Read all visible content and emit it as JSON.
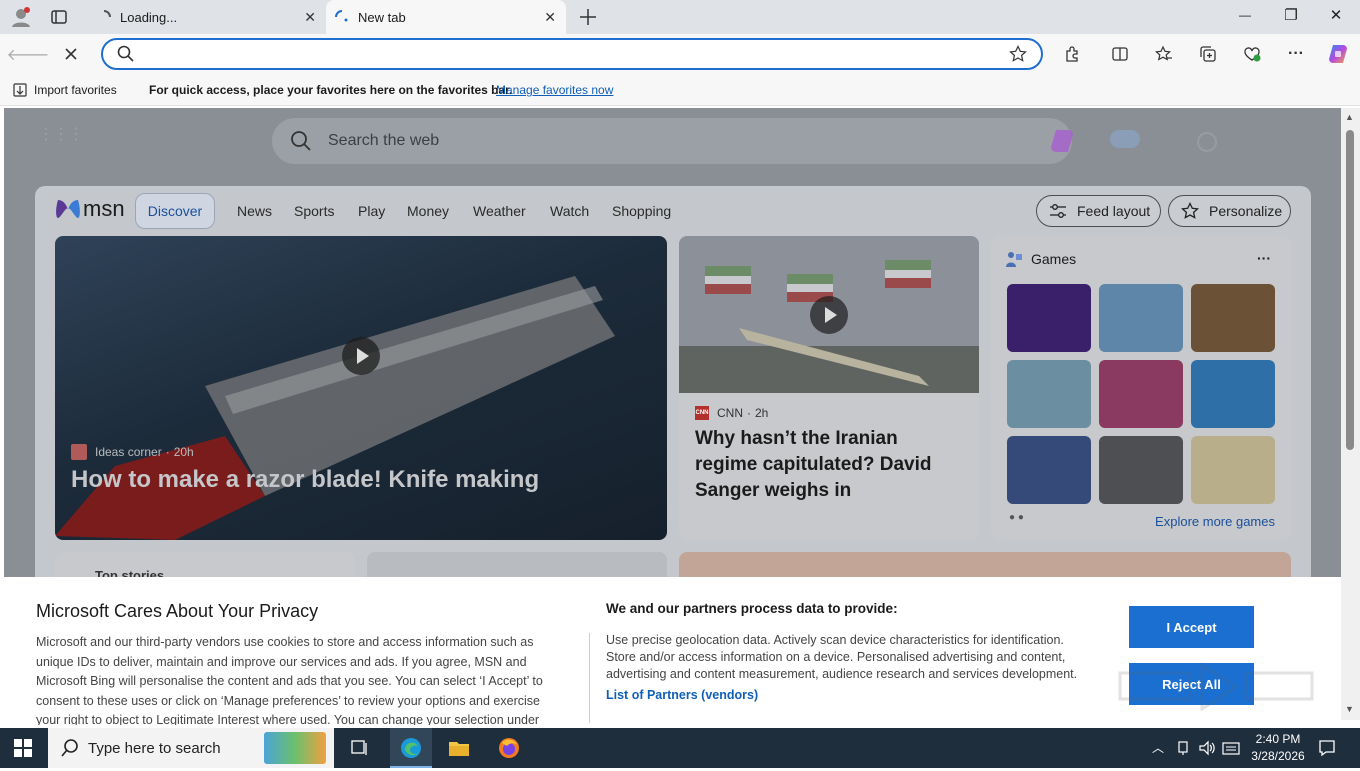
{
  "tabs": [
    {
      "title": "Loading...",
      "close": "✕"
    },
    {
      "title": "New tab",
      "close": "✕"
    }
  ],
  "window_controls": {
    "minimize": "—",
    "maximize": "❐",
    "close": "✕"
  },
  "address": {
    "value": "",
    "placeholder": ""
  },
  "favorites_bar": {
    "import_label": "Import favorites",
    "hint": "For quick access, place your favorites here on the favorites bar.",
    "manage_link": "Manage favorites now"
  },
  "ntp": {
    "search_placeholder": "Search the web",
    "logo_text": "msn",
    "nav": [
      "Discover",
      "News",
      "Sports",
      "Play",
      "Money",
      "Weather",
      "Watch",
      "Shopping"
    ],
    "feed_layout": "Feed layout",
    "personalize": "Personalize",
    "hero": {
      "source": "Ideas corner",
      "age": "20h",
      "title": "How to make a razor blade! Knife making"
    },
    "story2": {
      "source": "CNN",
      "source_badge": "CNN",
      "age": "2h",
      "title": "Why hasn’t the Iranian regime capitulated? David Sanger weighs in"
    },
    "games": {
      "title": "Games",
      "more": "···",
      "explore": "Explore more games"
    },
    "top_stories": "Top stories"
  },
  "privacy": {
    "title": "Microsoft Cares About Your Privacy",
    "body": "Microsoft and our third-party vendors use cookies to store and access information such as unique IDs to deliver, maintain and improve our services and ads. If you agree, MSN and Microsoft Bing will personalise the content and ads that you see. You can select ‘I Accept’ to consent to these uses or click on ‘Manage preferences’ to review your options and exercise your right to object to Legitimate Interest where used. You can change your selection under",
    "process_title": "We and our partners process data to provide:",
    "process_desc": "Use precise geolocation data. Actively scan device characteristics for identification. Store and/or access information on a device. Personalised advertising and content, advertising and content measurement, audience research and services development.",
    "partners_link": "List of Partners (vendors)",
    "accept": "I Accept",
    "reject": "Reject All"
  },
  "taskbar": {
    "search_placeholder": "Type here to search",
    "time": "2:40 PM",
    "date": "3/28/2026"
  },
  "colors": {
    "accent": "#1a6fd1",
    "taskbar": "#1f2e3d"
  }
}
